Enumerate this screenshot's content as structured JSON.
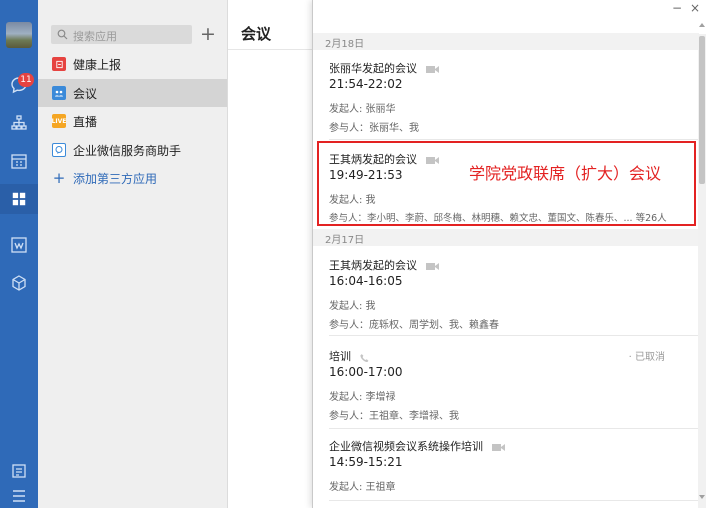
{
  "sidebar": {
    "badge_count": "11",
    "icons": [
      "avatar",
      "chat-icon",
      "org-chart-icon",
      "calendar-icon",
      "apps-grid-icon",
      "doc-icon",
      "box-icon",
      "notes-icon",
      "menu-icon"
    ]
  },
  "app_list": {
    "search_placeholder": "搜索应用",
    "add_symbol": "+",
    "items": [
      {
        "label": "健康上报",
        "icon": "health-report-icon",
        "color": "#e64340"
      },
      {
        "label": "会议",
        "icon": "meeting-icon",
        "color": "#3b8ad9",
        "selected": true
      },
      {
        "label": "直播",
        "icon": "live-icon",
        "color": "#f5a623",
        "icon_text": "LIVE"
      },
      {
        "label": "企业微信服务商助手",
        "icon": "service-helper-icon",
        "color": "#3b8ad9"
      }
    ],
    "add_third_party": "添加第三方应用"
  },
  "main": {
    "title": "会议"
  },
  "dialog": {
    "minimize": "−",
    "close": "×",
    "groups": [
      {
        "date": "2月18日",
        "meetings": [
          {
            "title": "张丽华发起的会议",
            "time": "21:54-22:02",
            "organizer": "发起人: 张丽华",
            "participants": "参与人：张丽华、我",
            "type": "video"
          },
          {
            "title": "王其炳发起的会议",
            "time": "19:49-21:53",
            "organizer": "发起人: 我",
            "participants": "参与人：李小明、李蔚、邱冬梅、林明穗、赖文忠、董国文、陈春乐、... 等26人",
            "type": "video"
          }
        ]
      },
      {
        "date": "2月17日",
        "meetings": [
          {
            "title": "王其炳发起的会议",
            "time": "16:04-16:05",
            "organizer": "发起人: 我",
            "participants": "参与人：庞轹权、周学划、我、赖鑫春",
            "type": "video"
          },
          {
            "title": "培训",
            "time": "16:00-17:00",
            "organizer": "发起人: 李增禄",
            "participants": "参与人：王祖章、李增禄、我",
            "type": "phone",
            "status": "· 已取消"
          },
          {
            "title": "企业微信视频会议系统操作培训",
            "time": "14:59-15:21",
            "organizer": "发起人: 王祖章",
            "type": "video"
          }
        ]
      }
    ]
  },
  "annotation": {
    "text": "学院党政联席（扩大）会议",
    "color": "#e32222"
  }
}
